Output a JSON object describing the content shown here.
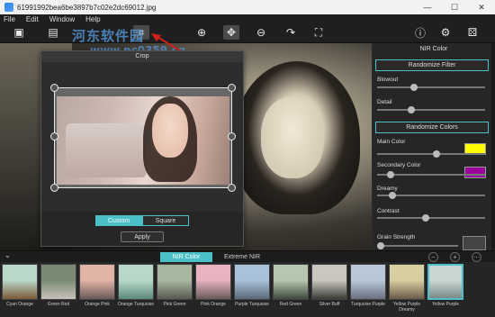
{
  "window": {
    "title": "61991992bea6be3897b7c02e2dc69012.jpg",
    "minimize": "—",
    "maximize": "☐",
    "close": "✕"
  },
  "menu": {
    "items": [
      "File",
      "Edit",
      "Window",
      "Help"
    ]
  },
  "watermark": {
    "text": "河东软件园",
    "url": "www.pc0359.cn"
  },
  "crop_panel": {
    "title": "Crop",
    "segments": [
      "Custom",
      "Square"
    ],
    "apply_label": "Apply"
  },
  "right_panel": {
    "title": "NIR Color",
    "randomize_filter": "Randomize Filter",
    "randomize_colors": "Randomize Colors",
    "sliders": [
      {
        "label": "Blowout",
        "value": 0.33
      },
      {
        "label": "Detail",
        "value": 0.3
      },
      {
        "label": "Main Color",
        "value": 0.55,
        "swatch": "#ffff00"
      },
      {
        "label": "Secondary Color",
        "value": 0.1,
        "swatch": "#9a009a"
      },
      {
        "label": "Dreamy",
        "value": 0.12
      },
      {
        "label": "Contrast",
        "value": 0.45
      },
      {
        "label": "Grain Strength",
        "value": 0.0
      }
    ]
  },
  "strip": {
    "tabs": [
      "NIR Color",
      "Extreme NIR"
    ],
    "thumbs": [
      {
        "label": "Cyan Orange",
        "c1": "#b9d9c9",
        "c2": "#7a5a3a"
      },
      {
        "label": "Green Red",
        "c1": "#7a8a72",
        "c2": "#c7c2b8"
      },
      {
        "label": "Orange Pink",
        "c1": "#e2b4a8",
        "c2": "#6b5a55"
      },
      {
        "label": "Orange Turquoise",
        "c1": "#b9d8c9",
        "c2": "#5a8a7a"
      },
      {
        "label": "Pink Green",
        "c1": "#a8b8a0",
        "c2": "#595a50"
      },
      {
        "label": "Pink Orange",
        "c1": "#e9b4c0",
        "c2": "#6a5a5a"
      },
      {
        "label": "Purple Turquoise",
        "c1": "#a9c2d9",
        "c2": "#5a6a7a"
      },
      {
        "label": "Red Green",
        "c1": "#b6c7b0",
        "c2": "#3d4a3a"
      },
      {
        "label": "Silver Buff",
        "c1": "#c9c7c0",
        "c2": "#3a3a35"
      },
      {
        "label": "Turquoise Purple",
        "c1": "#b8c8d8",
        "c2": "#6a7080"
      },
      {
        "label": "Yellow Purple Dreamy",
        "c1": "#d8cfa0",
        "c2": "#6a5a4a"
      },
      {
        "label": "Yellow Purple",
        "c1": "#c8d7d2",
        "c2": "#7a8a8a"
      }
    ]
  }
}
